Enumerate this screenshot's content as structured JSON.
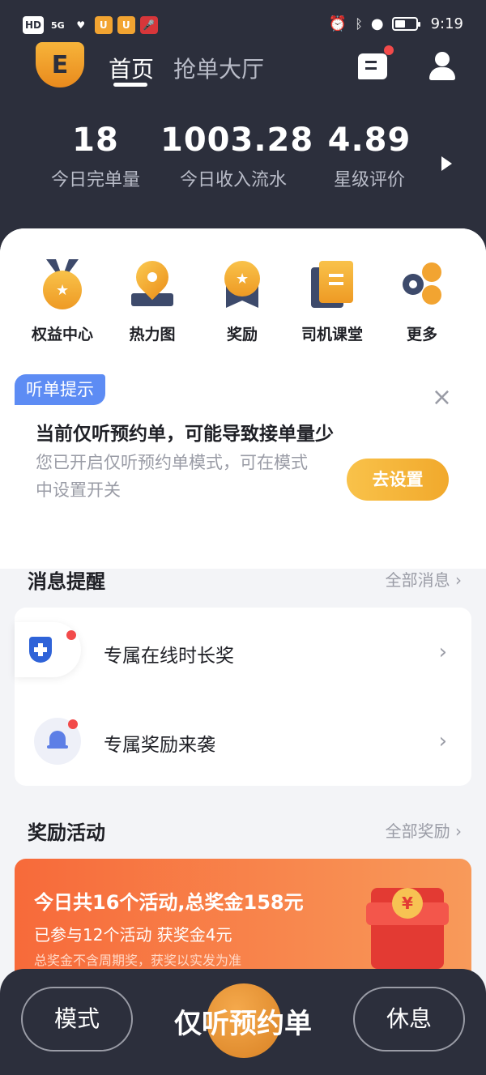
{
  "status_bar": {
    "left_chips": [
      "HD",
      "5G",
      "♥",
      "U",
      "U",
      "🎤"
    ],
    "time": "9:19"
  },
  "header": {
    "logo_letter": "E",
    "tabs": [
      {
        "label": "首页",
        "active": true
      },
      {
        "label": "抢单大厅",
        "active": false
      }
    ]
  },
  "stats": [
    {
      "value": "18",
      "label": "今日完单量"
    },
    {
      "value": "1003.28",
      "label": "今日收入流水"
    },
    {
      "value": "4.89",
      "label": "星级评价"
    }
  ],
  "quick_actions": [
    {
      "label": "权益中心",
      "icon": "medal-icon"
    },
    {
      "label": "热力图",
      "icon": "map-pin-icon"
    },
    {
      "label": "奖励",
      "icon": "award-icon"
    },
    {
      "label": "司机课堂",
      "icon": "book-icon"
    },
    {
      "label": "更多",
      "icon": "more-icon"
    }
  ],
  "notice": {
    "tag": "听单提示",
    "title": "当前仅听预约单，可能导致接单量少",
    "desc": "您已开启仅听预约单模式，可在模式中设置开关",
    "button": "去设置"
  },
  "messages": {
    "title": "消息提醒",
    "more": "全部消息",
    "items": [
      {
        "text": "专属在线时长奖",
        "icon": "shield-plus-icon"
      },
      {
        "text": "专属奖励来袭",
        "icon": "bell-icon"
      }
    ]
  },
  "rewards": {
    "title": "奖励活动",
    "more": "全部奖励",
    "promo_title": "今日共16个活动,总奖金158元",
    "promo_sub": "已参与12个活动 获奖金4元",
    "promo_note": "总奖金不含周期奖，获奖以实发为准"
  },
  "bottom": {
    "left": "模式",
    "center": "仅听预约单",
    "right": "休息"
  },
  "colors": {
    "dark_bg": "#2c2f3c",
    "accent_orange": "#f1a92c",
    "tag_blue": "#5d8cf4",
    "alert_red": "#f24a4a"
  }
}
